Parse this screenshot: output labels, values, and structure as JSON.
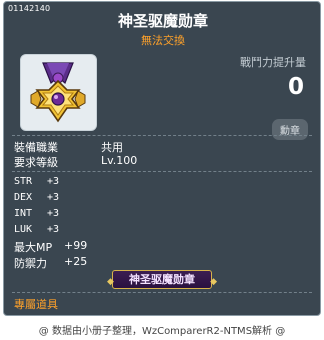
{
  "item": {
    "id": "01142140",
    "name": "神圣驱魔勋章",
    "trade_note": "無法交換",
    "icon": "medal-icon"
  },
  "power": {
    "label": "戰鬥力提升量",
    "value": "0",
    "badge": "勳章"
  },
  "info": [
    {
      "label": "裝備職業",
      "value": "共用"
    },
    {
      "label": "要求等級",
      "value": "Lv.100"
    }
  ],
  "stats": [
    {
      "label": "STR",
      "value": "+3"
    },
    {
      "label": "DEX",
      "value": "+3"
    },
    {
      "label": "INT",
      "value": "+3"
    },
    {
      "label": "LUK",
      "value": "+3"
    },
    {
      "label": "最大MP",
      "value": "+99"
    },
    {
      "label": "防禦力",
      "value": "+25"
    }
  ],
  "medal_title": "神圣驱魔勋章",
  "exclusive": "專屬道具",
  "footer": "@ 数据由小册子整理，WzComparerR2-NTMS解析 @",
  "colors": {
    "panel_bg": "#3a4650",
    "orange": "#ffa22a",
    "text": "#ffffff"
  }
}
